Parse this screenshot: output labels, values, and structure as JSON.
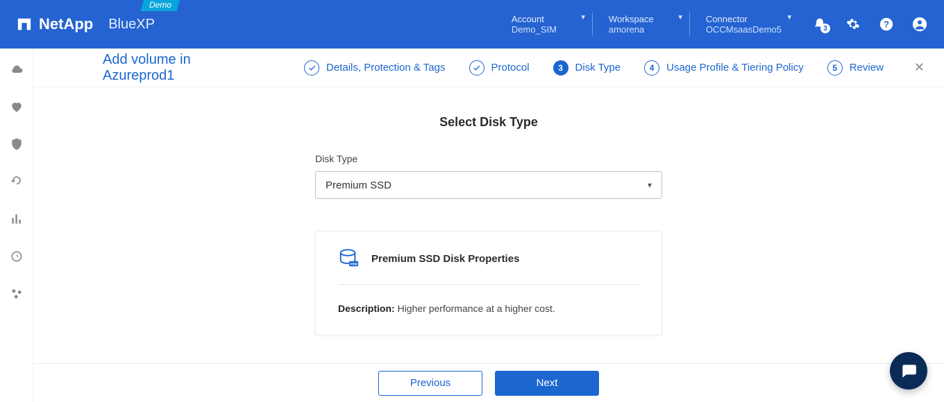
{
  "header": {
    "demo_tag": "Demo",
    "brand": "NetApp",
    "product": "BlueXP",
    "account_label": "Account",
    "account_value": "Demo_SIM",
    "workspace_label": "Workspace",
    "workspace_value": "amorena",
    "connector_label": "Connector",
    "connector_value": "OCCMsaasDemo5",
    "notification_count": "3"
  },
  "wizard": {
    "title": "Add volume in Azureprod1",
    "steps": [
      {
        "num": "1",
        "label": "Details, Protection & Tags",
        "state": "done"
      },
      {
        "num": "2",
        "label": "Protocol",
        "state": "done"
      },
      {
        "num": "3",
        "label": "Disk Type",
        "state": "current"
      },
      {
        "num": "4",
        "label": "Usage Profile & Tiering Policy",
        "state": "todo"
      },
      {
        "num": "5",
        "label": "Review",
        "state": "todo"
      }
    ]
  },
  "main": {
    "section_title": "Select Disk Type",
    "disk_type_label": "Disk Type",
    "disk_type_value": "Premium SSD",
    "card_title": "Premium SSD Disk Properties",
    "card_icon_badge": "PRM",
    "desc_label": "Description:",
    "desc_value": "Higher performance at a higher cost."
  },
  "footer": {
    "prev": "Previous",
    "next": "Next"
  }
}
